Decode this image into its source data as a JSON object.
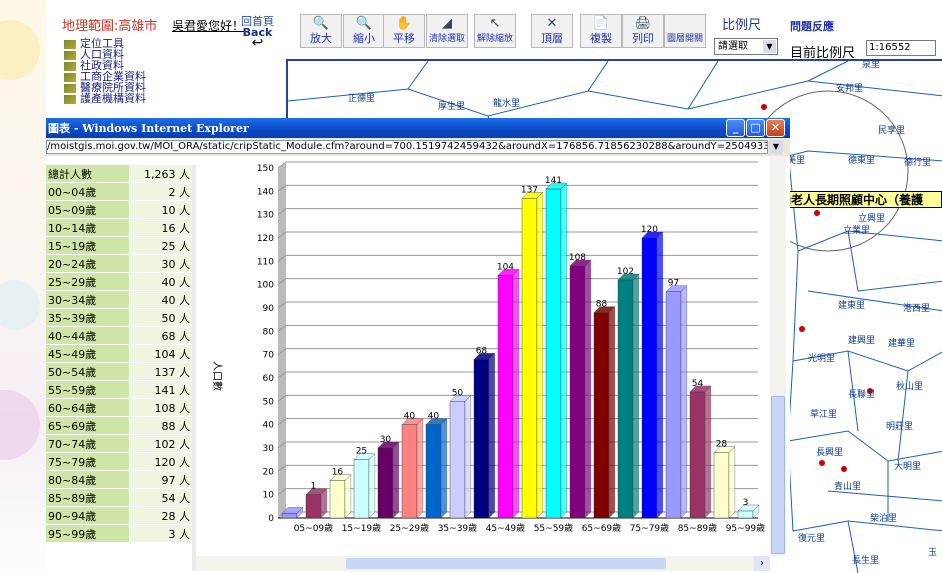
{
  "app": {
    "region": "地理範圍:高雄市",
    "greeting": "吳君愛您好！",
    "home_label": "回首頁",
    "back_label": "Back",
    "menu": [
      "定位工具",
      "人口資料",
      "社政資料",
      "工商企業資料",
      "醫療院所資料",
      "護產機構資料"
    ],
    "tools": [
      {
        "icon": "zoom-in-icon",
        "glyph": "🔍",
        "label": "放大"
      },
      {
        "icon": "zoom-out-icon",
        "glyph": "🔍",
        "label": "縮小"
      },
      {
        "icon": "pan-hand-icon",
        "glyph": "✋",
        "label": "平移"
      },
      {
        "icon": "eraser-icon",
        "glyph": "◢",
        "label": "清除選取"
      },
      {
        "icon": "pointer-icon",
        "glyph": "↖",
        "label": "解除縮放"
      },
      {
        "icon": "zoom-top-icon",
        "glyph": "✕",
        "label": "頂層"
      },
      {
        "icon": "copy-icon",
        "glyph": "📄",
        "label": "複製"
      },
      {
        "icon": "print-icon",
        "glyph": "🖨",
        "label": "列印"
      },
      {
        "icon": "layers-icon",
        "glyph": "",
        "label": "圖層開關"
      }
    ],
    "scale_label": "比例尺",
    "feedback_label": "問題反應",
    "scale_select": "請選取",
    "current_scale_label": "目前比例尺",
    "current_scale_value": "1:16552"
  },
  "map": {
    "labels": [
      "正德里",
      "厚生里",
      "龍水里",
      "安邦里",
      "泉里",
      "民享里",
      "十美里",
      "德東里",
      "德行里",
      "立興里",
      "立業里",
      "建東里",
      "港西里",
      "建興里",
      "建華里",
      "光明里",
      "長聯里",
      "秋山里",
      "草江里",
      "明莊里",
      "長興里",
      "大明里",
      "青山里",
      "柴泊里",
      "復元里",
      "長生里",
      "玉"
    ],
    "tooltip": "私立普納老人長期照顧中心（養護"
  },
  "popup": {
    "title": "圖表 - Windows Internet Explorer",
    "address": "/moistgis.moi.gov.tw/MOI_ORA/static/cripStatic_Module.cfm?around=700.1519742459432&aroundX=176856.71856230288&aroundY=2504933.2625319976",
    "table": [
      {
        "k": "總計人數",
        "v": "1,263 人"
      },
      {
        "k": "00~04歲",
        "v": "2 人"
      },
      {
        "k": "05~09歲",
        "v": "10 人"
      },
      {
        "k": "10~14歲",
        "v": "16 人"
      },
      {
        "k": "15~19歲",
        "v": "25 人"
      },
      {
        "k": "20~24歲",
        "v": "30 人"
      },
      {
        "k": "25~29歲",
        "v": "40 人"
      },
      {
        "k": "30~34歲",
        "v": "40 人"
      },
      {
        "k": "35~39歲",
        "v": "50 人"
      },
      {
        "k": "40~44歲",
        "v": "68 人"
      },
      {
        "k": "45~49歲",
        "v": "104 人"
      },
      {
        "k": "50~54歲",
        "v": "137 人"
      },
      {
        "k": "55~59歲",
        "v": "141 人"
      },
      {
        "k": "60~64歲",
        "v": "108 人"
      },
      {
        "k": "65~69歲",
        "v": "88 人"
      },
      {
        "k": "70~74歲",
        "v": "102 人"
      },
      {
        "k": "75~79歲",
        "v": "120 人"
      },
      {
        "k": "80~84歲",
        "v": "97 人"
      },
      {
        "k": "85~89歲",
        "v": "54 人"
      },
      {
        "k": "90~94歲",
        "v": "28 人"
      },
      {
        "k": "95~99歲",
        "v": "3 人"
      }
    ]
  },
  "chart_data": {
    "type": "bar",
    "ylabel": "人口數",
    "xlabel": "",
    "ylim": [
      0,
      150
    ],
    "yticks": [
      0,
      10,
      20,
      30,
      40,
      50,
      60,
      70,
      80,
      90,
      100,
      110,
      120,
      130,
      140,
      150
    ],
    "categories": [
      "00~04歲",
      "05~09歲",
      "10~14歲",
      "15~19歲",
      "20~24歲",
      "25~29歲",
      "30~34歲",
      "35~39歲",
      "40~44歲",
      "45~49歲",
      "50~54歲",
      "55~59歲",
      "60~64歲",
      "65~69歲",
      "70~74歲",
      "75~79歲",
      "80~84歲",
      "85~89歲",
      "90~94歲",
      "95~99歲"
    ],
    "values": [
      2,
      10,
      16,
      25,
      30,
      40,
      40,
      50,
      68,
      104,
      137,
      141,
      108,
      88,
      102,
      120,
      97,
      54,
      28,
      3
    ],
    "xtick_labels": [
      "05~09歲",
      "15~19歲",
      "25~29歲",
      "35~39歲",
      "45~49歲",
      "55~59歲",
      "65~69歲",
      "75~79歲",
      "85~89歲",
      "95~99歲"
    ],
    "data_labels": [
      "",
      "1",
      "16",
      "25",
      "30",
      "40",
      "40",
      "50",
      "68",
      "104",
      "137",
      "141",
      "108",
      "88",
      "102",
      "120",
      "97",
      "54",
      "28",
      "3"
    ],
    "colors": [
      "#9999ff",
      "#993366",
      "#ffffcc",
      "#ccffff",
      "#660066",
      "#ff8080",
      "#0066cc",
      "#ccccff",
      "#000080",
      "#ff00ff",
      "#ffff00",
      "#00ffff",
      "#800080",
      "#800000",
      "#008080",
      "#0000ff",
      "#9999ff",
      "#993366",
      "#ffffcc",
      "#ccffff"
    ]
  }
}
